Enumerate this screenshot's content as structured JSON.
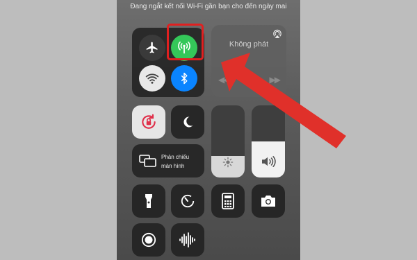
{
  "banner_text": "Đang ngắt kết nối Wi-Fi gần bạn cho đến ngày mai",
  "connectivity": {
    "airplane_icon": "airplane-icon",
    "cellular_icon": "cellular-antenna-icon",
    "wifi_icon": "wifi-icon",
    "bluetooth_icon": "bluetooth-icon",
    "cellular_color": "#34c759",
    "bluetooth_color": "#0a84ff"
  },
  "media": {
    "title": "Không phát",
    "prev_symbol": "◀◀",
    "play_symbol": "▶",
    "next_symbol": "▶▶"
  },
  "screen_mirroring": {
    "line1": "Phản chiếu",
    "line2": "màn hình"
  },
  "brightness_level": 0.3,
  "volume_level": 0.5,
  "annotation_color": "#e02020"
}
